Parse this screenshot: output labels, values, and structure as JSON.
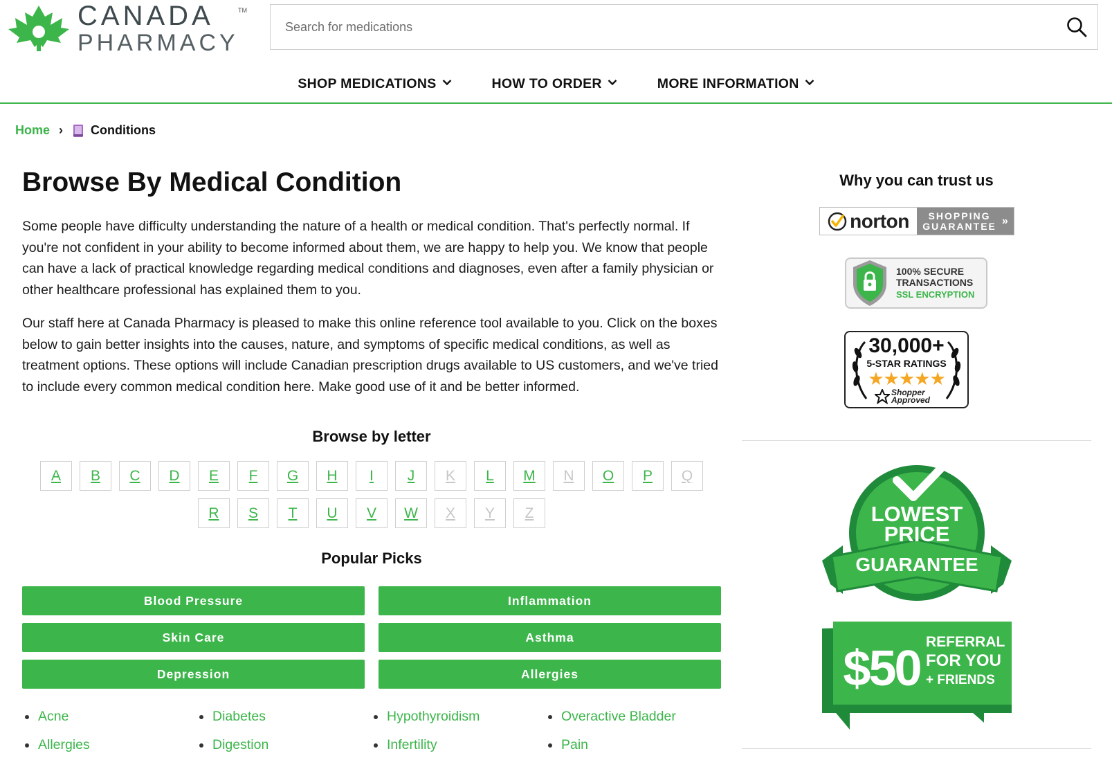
{
  "logo": {
    "line1": "CANADA",
    "line2": "PHARMACY",
    "tm": "TM"
  },
  "search": {
    "placeholder": "Search for medications"
  },
  "nav": [
    {
      "label": "SHOP MEDICATIONS"
    },
    {
      "label": "HOW TO ORDER"
    },
    {
      "label": "MORE INFORMATION"
    }
  ],
  "breadcrumb": {
    "home": "Home",
    "separator": "›",
    "current": "Conditions"
  },
  "main": {
    "title": "Browse By Medical Condition",
    "paragraphs": [
      "Some people have difficulty understanding the nature of a health or medical condition. That's perfectly normal. If you're not confident in your ability to become informed about them, we are happy to help you. We know that people can have a lack of practical knowledge regarding medical conditions and diagnoses, even after a family physician or other healthcare professional has explained them to you.",
      "Our staff here at Canada Pharmacy is pleased to make this online reference tool available to you. Click on the boxes below to gain better insights into the causes, nature, and symptoms of specific medical conditions, as well as treatment options. These options will include Canadian prescription drugs available to US customers, and we've tried to include every common medical condition here. Make good use of it and be better informed."
    ],
    "browse_title": "Browse by letter",
    "letters_row1": [
      "A",
      "B",
      "C",
      "D",
      "E",
      "F",
      "G",
      "H",
      "I",
      "J",
      "K",
      "L",
      "M",
      "N",
      "O",
      "P",
      "Q"
    ],
    "letters_row2": [
      "R",
      "S",
      "T",
      "U",
      "V",
      "W",
      "X",
      "Y",
      "Z"
    ],
    "disabled_letters": [
      "K",
      "N",
      "Q",
      "X",
      "Y",
      "Z"
    ],
    "popular_title": "Popular Picks",
    "popular": [
      "Blood Pressure",
      "Inflammation",
      "Skin Care",
      "Asthma",
      "Depression",
      "Allergies"
    ],
    "conditions": [
      "Acne",
      "Diabetes",
      "Hypothyroidism",
      "Overactive Bladder",
      "Allergies",
      "Digestion",
      "Infertility",
      "Pain"
    ]
  },
  "sidebar": {
    "trust_title": "Why you can trust us",
    "norton": {
      "brand": "norton",
      "line1": "SHOPPING",
      "line2": "GUARANTEE",
      "arrow": "»"
    },
    "ssl": {
      "line1": "100% SECURE",
      "line2": "TRANSACTIONS",
      "line3": "SSL ENCRYPTION"
    },
    "rating": {
      "count": "30,000+",
      "label": "5-STAR RATINGS",
      "stars": "★★★★★",
      "line1": "Shopper",
      "line2": "Approved"
    },
    "lowest": {
      "line1": "LOWEST",
      "line2": "PRICE",
      "line3": "GUARANTEE"
    },
    "referral": {
      "amount": "$50",
      "line1": "REFERRAL",
      "line2": "FOR YOU",
      "line3": "+ FRIENDS"
    }
  },
  "colors": {
    "brand_green": "#3cb54a",
    "dark_green": "#1f8a3a",
    "text": "#111111",
    "disabled": "#c7c7c7"
  }
}
